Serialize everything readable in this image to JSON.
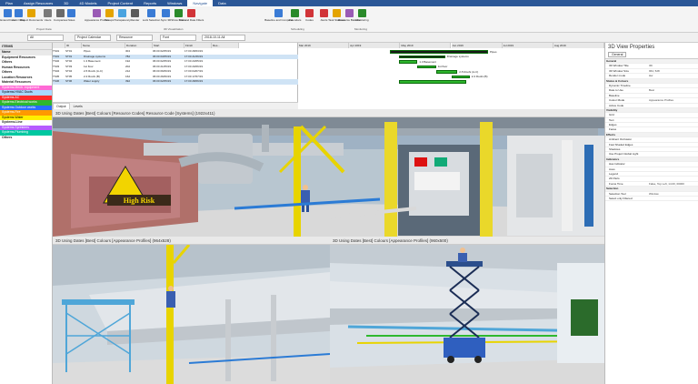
{
  "menu": [
    "Plan",
    "Assign Resources",
    "3D",
    "4D Models",
    "Project Content",
    "Reports",
    "Windows",
    "Navigate",
    "Data"
  ],
  "ribbon": {
    "buttons": [
      "Extend Data",
      "Link Data",
      "Project Documents",
      "Users",
      "Companies",
      "Notes",
      "Appearance Profiles",
      "Groups",
      "Transparency",
      "Render",
      "Lock Selection",
      "Sync 3D",
      "Show Filters",
      "Text and Date Filters",
      "Baseline and Compare",
      "Calendars",
      "Codes",
      "Alerts",
      "Task Statuses",
      "Resource Balance",
      "Monitoring"
    ],
    "groups": [
      "Project Data",
      "3D Visualization",
      "Scheduling",
      "Monitoring"
    ]
  },
  "toolbar": {
    "field1": "All",
    "field2": "Project Calendar",
    "field3": "Resource",
    "field4": "Font",
    "field5": "2018-10-11 All"
  },
  "left_panel": {
    "header": "Name",
    "title": "ITEMS",
    "rows": [
      {
        "label": "Equipment Resources",
        "color": "#ffffff"
      },
      {
        "label": "Others",
        "color": "#ffffff"
      },
      {
        "label": "Human Resources",
        "color": "#ffffff"
      },
      {
        "label": "Others",
        "color": "#ffffff"
      },
      {
        "label": "Location Resources",
        "color": "#ffffff"
      },
      {
        "label": "Material Resources",
        "color": "#ffffff"
      },
      {
        "label": "Systems.Mech. equipment",
        "color": "#ff6ad5"
      },
      {
        "label": "Systems.HVAC Ducts",
        "color": "#a8d8ff"
      },
      {
        "label": "Systems.AC",
        "color": "#ff2a2a"
      },
      {
        "label": "Systems.Electrical works",
        "color": "#2eb82e"
      },
      {
        "label": "Systems.Outdoor works",
        "color": "#2a6cff"
      },
      {
        "label": "Systems.Fire",
        "color": "#ff9900"
      },
      {
        "label": "Systems.Water",
        "color": "#ffee00"
      },
      {
        "label": "Systems.Line",
        "color": "#ffffff"
      },
      {
        "label": "Systems.Sprinklers",
        "color": "#b65cff"
      },
      {
        "label": "Systems.Plumbing",
        "color": "#00c8a0"
      },
      {
        "label": "Others",
        "color": "#ffffff"
      }
    ]
  },
  "grid": {
    "columns": [
      "ID",
      "Name",
      "Duration",
      "Start",
      "Finish",
      "Res..."
    ],
    "rows": [
      {
        "id": "TS01",
        "code": "ST01",
        "name": "Pipes",
        "dur": "304",
        "start": "06:00 02/05/19",
        "finish": "17:00 28/03/19",
        "sel": false
      },
      {
        "id": "TS01",
        "code": "ST01",
        "name": "Drainage systems",
        "dur": "78d",
        "start": "06:00 03/05/19",
        "finish": "17:00 21/06/19",
        "sel": true
      },
      {
        "id": "TS02",
        "code": "ST02",
        "name": "1.3 Basement",
        "dur": "19d",
        "start": "06:00 02/05/19",
        "finish": "17:00 23/05/19",
        "sel": false
      },
      {
        "id": "TS03",
        "code": "ST03",
        "name": "1st floor",
        "dur": "20d",
        "start": "06:00 21/05/19",
        "finish": "17:00 20/06/19",
        "sel": false
      },
      {
        "id": "TS04",
        "code": "ST04",
        "name": "2-5 Roofs (A-C)",
        "dur": "21d",
        "start": "06:00 06/06/19",
        "finish": "17:00 04/07/19",
        "sel": false
      },
      {
        "id": "TS05",
        "code": "ST05",
        "name": "2-3 Roofs (B)",
        "dur": "16d",
        "start": "06:00 26/06/19",
        "finish": "17:00 17/07/19",
        "sel": false
      },
      {
        "id": "TS06",
        "code": "ST06",
        "name": "Water supply",
        "dur": "39d",
        "start": "06:00 02/05/19",
        "finish": "17:00 28/06/19",
        "sel": true
      }
    ]
  },
  "gantt": {
    "months": [
      "Mar 2019",
      "Apr 2019",
      "May 2019",
      "Jun 2019",
      "Jul 2019",
      "Aug 2019"
    ],
    "bars": [
      {
        "label": "Pipes",
        "start": 0.3,
        "end": 0.62
      },
      {
        "label": "Drainage systems",
        "start": 0.33,
        "end": 0.48
      },
      {
        "label": "1.3 Basement",
        "start": 0.33,
        "end": 0.39
      },
      {
        "label": "1st floor",
        "start": 0.39,
        "end": 0.45
      },
      {
        "label": "2-5 Roofs (A-C)",
        "start": 0.45,
        "end": 0.52
      },
      {
        "label": "2-3 Roofs (B)",
        "start": 0.5,
        "end": 0.56
      },
      {
        "label": "",
        "start": 0.33,
        "end": 0.55
      }
    ]
  },
  "bottom_tabs": [
    "Output",
    "Levels"
  ],
  "views": {
    "main": "3D Using Dates [Best] Colours [Resource Codes] Resource Code [Systems] (1922x411)",
    "left": "3D Using Dates [Best] Colours [Appearance Profiles] (964x528)",
    "right": "3D Using Dates [Best] Colours [Appearance Profiles] (960x500)",
    "sign": "High Risk"
  },
  "properties": {
    "title": "3D View Properties",
    "tab": "General",
    "rows": [
      {
        "k": "General",
        "v": "",
        "sec": true
      },
      {
        "k": "3D Window Title",
        "v": "3D"
      },
      {
        "k": "3D Window Size",
        "v": "964, 528"
      },
      {
        "k": "Render mode",
        "v": "Hw"
      },
      {
        "k": "Status & Colours",
        "v": "",
        "sec": true
      },
      {
        "k": "Dynamic Timeline",
        "v": ""
      },
      {
        "k": "Date to Use",
        "v": "Best"
      },
      {
        "k": "Baseline",
        "v": ""
      },
      {
        "k": "Colour Mode",
        "v": "Appearance Profiles"
      },
      {
        "k": "Active Code",
        "v": ""
      },
      {
        "k": "Visibility",
        "v": "",
        "sec": true
      },
      {
        "k": "Grid",
        "v": ""
      },
      {
        "k": "Text",
        "v": ""
      },
      {
        "k": "Edges",
        "v": ""
      },
      {
        "k": "Faces",
        "v": ""
      },
      {
        "k": "Effects",
        "v": "",
        "sec": true
      },
      {
        "k": "Ambient Occlusion",
        "v": ""
      },
      {
        "k": "Fast Shaded Edges",
        "v": ""
      },
      {
        "k": "Shadows",
        "v": ""
      },
      {
        "k": "Use Project Global Light",
        "v": ""
      },
      {
        "k": "Indicators",
        "v": "",
        "sec": true
      },
      {
        "k": "Has Indicator",
        "v": ""
      },
      {
        "k": "Axes",
        "v": ""
      },
      {
        "k": "Legend",
        "v": ""
      },
      {
        "k": "2D Parts",
        "v": ""
      },
      {
        "k": "Focus Time",
        "v": "False, Top Left, 14.00, 00000"
      },
      {
        "k": "Selection",
        "v": "",
        "sec": true
      },
      {
        "k": "Selection Tool",
        "v": "Window"
      },
      {
        "k": "Select only Filtered",
        "v": ""
      }
    ]
  }
}
